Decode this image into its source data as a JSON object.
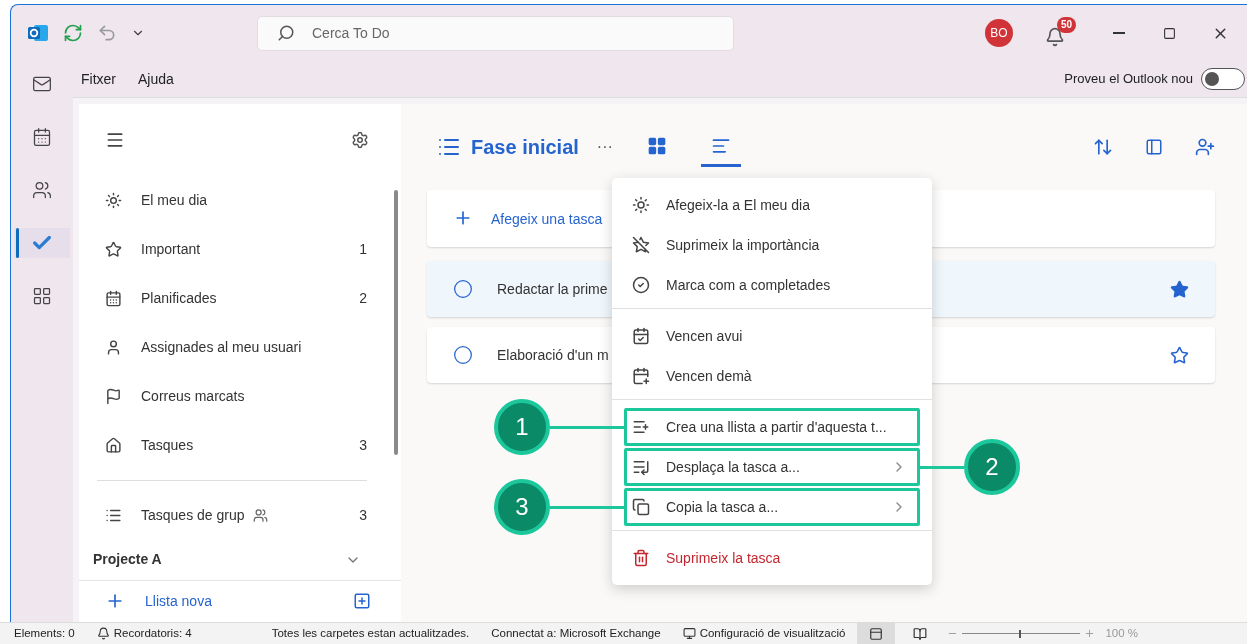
{
  "title_bar": {
    "search": {
      "placeholder": "Cerca To Do"
    },
    "avatar": {
      "initials": "BO"
    },
    "notifications": {
      "count": "50"
    }
  },
  "menu_bar": {
    "items": [
      "Fitxer",
      "Ajuda"
    ],
    "toggle": {
      "label": "Proveu el Outlook nou",
      "on": false
    }
  },
  "rail": [
    {
      "kind": "mail",
      "selected": false
    },
    {
      "kind": "calendar",
      "selected": false
    },
    {
      "kind": "people",
      "selected": false
    },
    {
      "kind": "todo",
      "selected": true
    },
    {
      "kind": "apps",
      "selected": false
    }
  ],
  "sidebar": {
    "lists": [
      {
        "kind": "sun",
        "label": "El meu dia"
      },
      {
        "kind": "star",
        "label": "Important",
        "count": "1"
      },
      {
        "kind": "calendar",
        "label": "Planificades",
        "count": "2"
      },
      {
        "kind": "person",
        "label": "Assignades al meu usuari"
      },
      {
        "kind": "flag",
        "label": "Correus marcats"
      },
      {
        "kind": "home",
        "label": "Tasques",
        "count": "3"
      }
    ],
    "group": {
      "label": "Tasques de grup",
      "count": "3"
    },
    "section": {
      "label": "Projecte A",
      "expanded": true
    },
    "new_list": "Llista nova"
  },
  "main": {
    "title": "Fase inicial",
    "more": "···",
    "views": [
      {
        "kind": "grid",
        "selected": false
      },
      {
        "kind": "list",
        "selected": true
      }
    ],
    "add_task": {
      "placeholder": "Afegeix una tasca"
    },
    "tasks": [
      {
        "title": "Redactar la prime",
        "important": true,
        "selected": true
      },
      {
        "title": "Elaboració d'un m",
        "important": false,
        "selected": false
      }
    ]
  },
  "context_menu": {
    "sections": [
      [
        {
          "kind": "sun",
          "label": "Afegeix-la a El meu dia"
        },
        {
          "kind": "unstar",
          "label": "Suprimeix la importància"
        },
        {
          "kind": "check",
          "label": "Marca com a completades"
        }
      ],
      [
        {
          "kind": "today",
          "label": "Vencen avui"
        },
        {
          "kind": "tomorrow",
          "label": "Vencen demà"
        }
      ],
      [
        {
          "kind": "newlist",
          "label": "Crea una llista a partir d'aquesta t...",
          "callout": "1",
          "callout_right": false
        },
        {
          "kind": "move",
          "label": "Desplaça la tasca a...",
          "submenu": true,
          "callout": "2",
          "callout_right": true
        },
        {
          "kind": "copy",
          "label": "Copia la tasca a...",
          "submenu": true,
          "callout": "3",
          "callout_right": false
        }
      ],
      [
        {
          "kind": "delete",
          "label": "Suprimeix la tasca"
        }
      ]
    ]
  },
  "status_bar": {
    "items": [
      {
        "kind": "text",
        "label": "Elements: 0"
      },
      {
        "kind": "bell",
        "label": "Recordatoris: 4"
      }
    ],
    "sync": "Totes les carpetes estan actualitzades.",
    "connection": "Connectat a: Microsoft Exchange",
    "display_settings": "Configuració de visualització",
    "views": [
      {
        "kind": "normal",
        "selected": true
      },
      {
        "kind": "reading",
        "selected": false
      }
    ],
    "zoom": {
      "level": 0.48,
      "reading": "100 %"
    }
  }
}
